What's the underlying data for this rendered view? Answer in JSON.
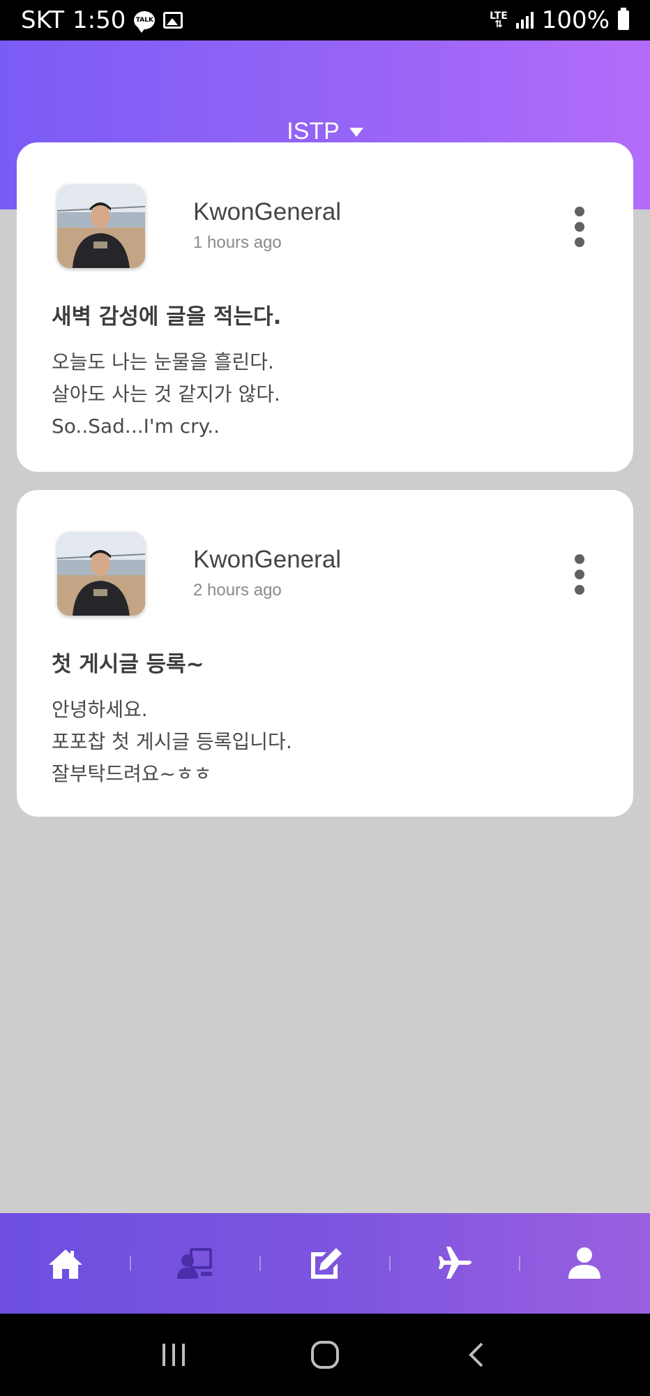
{
  "status_bar": {
    "carrier": "SKT",
    "time": "1:50",
    "talk_badge": "TALK",
    "network": "LTE",
    "battery": "100%"
  },
  "header": {
    "title": "ISTP"
  },
  "posts": [
    {
      "author": "KwonGeneral",
      "time": "1 hours ago",
      "title": "새벽 감성에 글을 적는다.",
      "body": [
        "오늘도 나는 눈물을 흘린다.",
        "살아도 사는 것 같지가 않다.",
        "So..Sad...I'm cry.."
      ]
    },
    {
      "author": "KwonGeneral",
      "time": "2 hours ago",
      "title": "첫 게시글 등록~",
      "body": [
        "안녕하세요.",
        "포포찹 첫 게시글 등록입니다.",
        "잘부탁드려요~ㅎㅎ"
      ]
    }
  ],
  "bottom_nav": {
    "items": [
      "home-icon",
      "profile-card-icon",
      "edit-icon",
      "airplane-icon",
      "user-icon"
    ],
    "active_index": 1,
    "colors": {
      "active": "#4a2fa8",
      "inactive": "#ffffff"
    }
  },
  "colors": {
    "header_gradient_start": "#7a5cf5",
    "header_gradient_end": "#b36cf9",
    "background": "#cdcdcd",
    "card": "#ffffff"
  }
}
